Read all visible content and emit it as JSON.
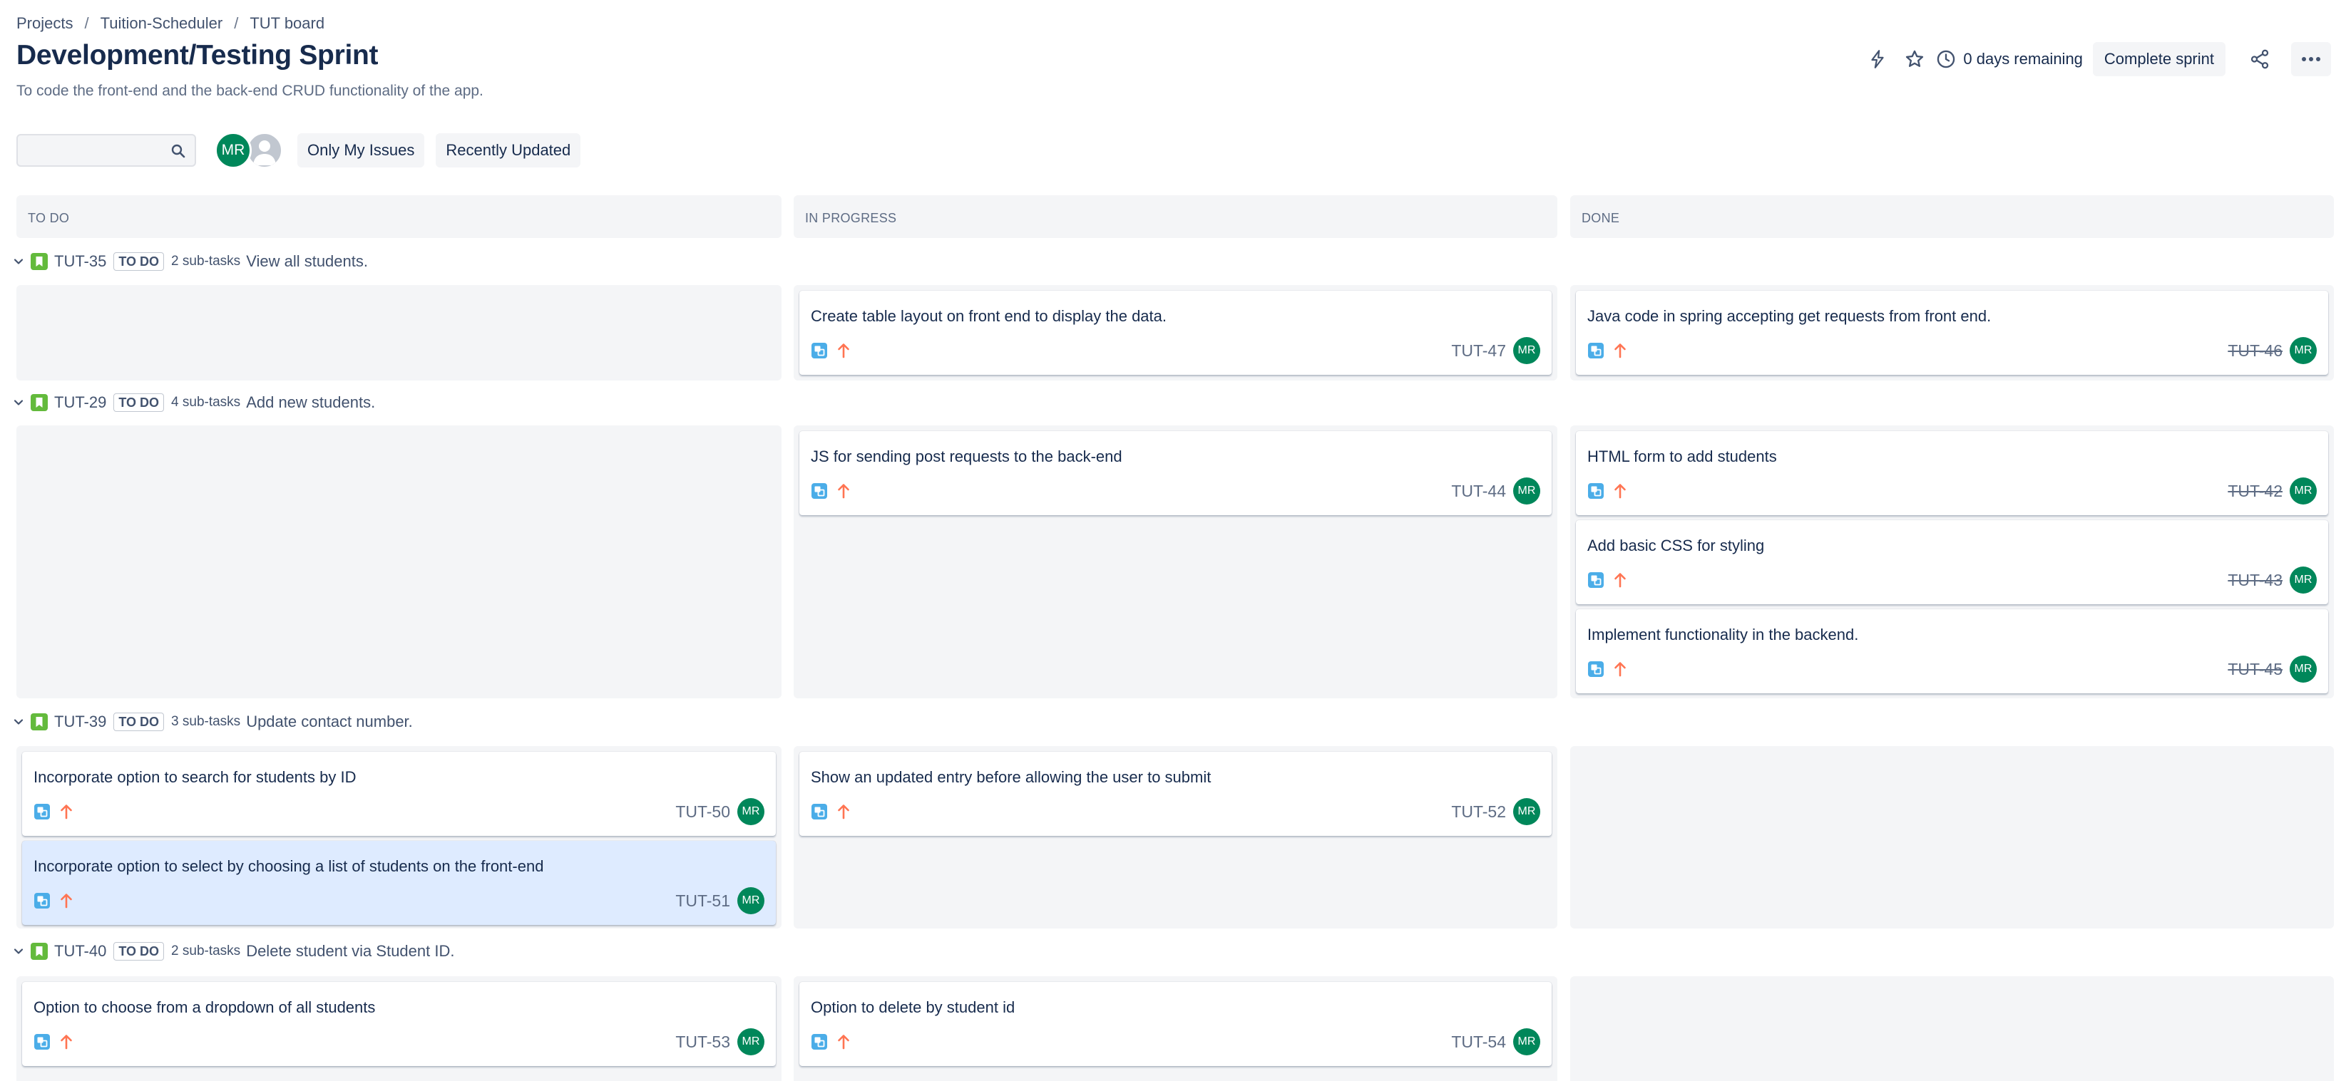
{
  "breadcrumb": {
    "items": [
      "Projects",
      "Tuition-Scheduler",
      "TUT board"
    ],
    "separator": "/"
  },
  "header": {
    "title": "Development/Testing Sprint",
    "description": "To code the front-end and the back-end CRUD functionality of the app.",
    "remaining": "0 days remaining",
    "complete_label": "Complete sprint",
    "icons": [
      "lightning-icon",
      "star-icon",
      "clock-icon",
      "share-icon",
      "more-icon"
    ]
  },
  "toolbar": {
    "search_placeholder": "",
    "avatar_initials": "MR",
    "filters": [
      "Only My Issues",
      "Recently Updated"
    ]
  },
  "columns": [
    "TO DO",
    "IN PROGRESS",
    "DONE"
  ],
  "swimlanes": [
    {
      "key": "TUT-35",
      "status": "TO DO",
      "subtasks": "2 sub-tasks",
      "summary": "View all students.",
      "todo": [],
      "inprogress": [
        {
          "summary": "Create table layout on front end to display the data.",
          "key": "TUT-47",
          "assignee": "MR"
        }
      ],
      "done": [
        {
          "summary": "Java code in spring accepting get requests from front end.",
          "key": "TUT-46",
          "assignee": "MR"
        }
      ]
    },
    {
      "key": "TUT-29",
      "status": "TO DO",
      "subtasks": "4 sub-tasks",
      "summary": "Add new students.",
      "todo": [],
      "inprogress": [
        {
          "summary": "JS for sending post requests to the back-end",
          "key": "TUT-44",
          "assignee": "MR"
        }
      ],
      "done": [
        {
          "summary": "HTML form to add students",
          "key": "TUT-42",
          "assignee": "MR"
        },
        {
          "summary": "Add basic CSS for styling",
          "key": "TUT-43",
          "assignee": "MR"
        },
        {
          "summary": "Implement functionality in the backend.",
          "key": "TUT-45",
          "assignee": "MR"
        }
      ]
    },
    {
      "key": "TUT-39",
      "status": "TO DO",
      "subtasks": "3 sub-tasks",
      "summary": "Update contact number.",
      "todo": [
        {
          "summary": "Incorporate option to search for students by ID",
          "key": "TUT-50",
          "assignee": "MR"
        },
        {
          "summary": "Incorporate option to select by choosing a list of students on the front-end",
          "key": "TUT-51",
          "assignee": "MR"
        }
      ],
      "inprogress": [
        {
          "summary": "Show an updated entry before allowing the user to submit",
          "key": "TUT-52",
          "assignee": "MR"
        }
      ],
      "done": []
    },
    {
      "key": "TUT-40",
      "status": "TO DO",
      "subtasks": "2 sub-tasks",
      "summary": "Delete student via Student ID.",
      "todo": [
        {
          "summary": "Option to choose from a dropdown of all students",
          "key": "TUT-53",
          "assignee": "MR"
        }
      ],
      "inprogress": [
        {
          "summary": "Option to delete by student id",
          "key": "TUT-54",
          "assignee": "MR"
        }
      ],
      "done": []
    }
  ],
  "colors": {
    "subtask": "#4bade8",
    "priority": "#ff7452",
    "story": "#63ba3c",
    "avatar": "#00875a",
    "selected": "#deebff"
  }
}
